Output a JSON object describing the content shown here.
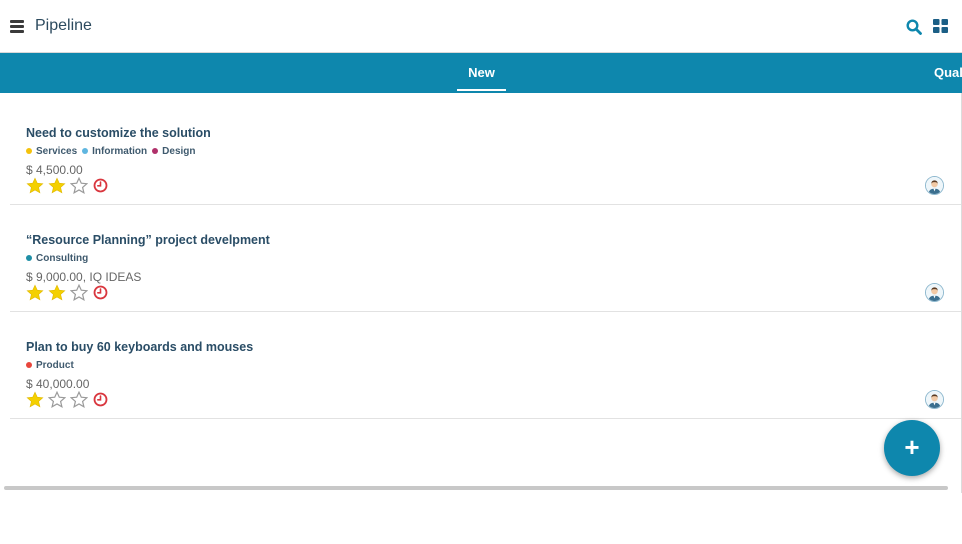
{
  "header": {
    "title": "Pipeline",
    "menu_icon": "hamburger-menu-icon",
    "search_icon": "search-icon",
    "view_icon": "grid-view-icon"
  },
  "stages": [
    {
      "label": "New",
      "active": true
    },
    {
      "label": "Qual",
      "active": false
    }
  ],
  "colors": {
    "accent": "#0e87ad",
    "title_text": "#2a4d66",
    "star_filled": "#f4d000",
    "activity_overdue": "#d9363e"
  },
  "opportunities": [
    {
      "title": "Need to customize the solution",
      "tags": [
        {
          "label": "Services",
          "color": "#f4c20d"
        },
        {
          "label": "Information",
          "color": "#5fb6e0"
        },
        {
          "label": "Design",
          "color": "#b0306a"
        }
      ],
      "amount": "$ 4,500.00",
      "rating": 2,
      "max_rating": 3
    },
    {
      "title": "“Resource Planning” project develpment",
      "tags": [
        {
          "label": "Consulting",
          "color": "#1f8fa6"
        }
      ],
      "amount": "$ 9,000.00, IQ IDEAS",
      "rating": 2,
      "max_rating": 3
    },
    {
      "title": "Plan to buy 60 keyboards and mouses",
      "tags": [
        {
          "label": "Product",
          "color": "#e8463c"
        }
      ],
      "amount": "$ 40,000.00",
      "rating": 1,
      "max_rating": 3
    }
  ],
  "fab": {
    "label": "+"
  }
}
